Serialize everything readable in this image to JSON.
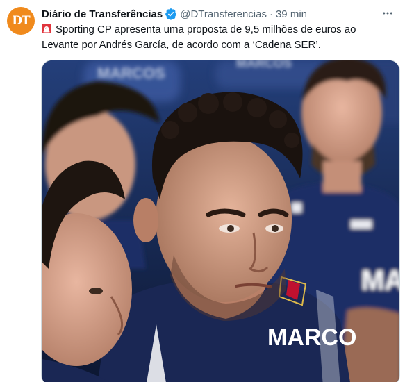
{
  "tweet": {
    "author": {
      "display_name": "Diário de Transferências",
      "handle": "@DTransferencias",
      "avatar_initials": "DT",
      "avatar_color": "#f08a1c",
      "verified": true
    },
    "separator": "·",
    "time": "39 min",
    "text": "Sporting CP apresenta uma proposta de 9,5 milhões de euros ao Levante por Andrés García, de acordo com a ‘Cadena SER’.",
    "emoji": "siren",
    "media": {
      "kind": "photo",
      "shirt_sponsor_text": [
        "MARCO",
        "MARCOS",
        "MARCOS"
      ],
      "shirt_badge_text": "MA"
    }
  },
  "colors": {
    "secondary_text": "#536471",
    "verified_blue": "#1d9bf0",
    "jersey_navy": "#1f2f66"
  }
}
